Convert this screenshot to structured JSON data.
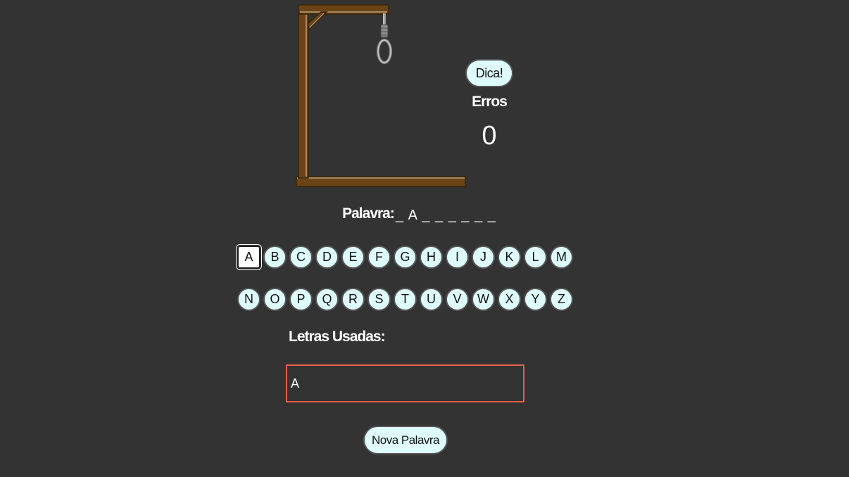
{
  "game": {
    "hint_label": "Dica!",
    "errors_label": "Erros",
    "errors_count": "0",
    "word_label": "Palavra:",
    "word_mask": "_ A _ _ _ _ _ _",
    "used_letters_label": "Letras Usadas:",
    "used_letters": "A",
    "new_word_label": "Nova Palavra"
  },
  "keyboard": {
    "row1": [
      "A",
      "B",
      "C",
      "D",
      "E",
      "F",
      "G",
      "H",
      "I",
      "J",
      "K",
      "L",
      "M"
    ],
    "row2": [
      "N",
      "O",
      "P",
      "Q",
      "R",
      "S",
      "T",
      "U",
      "V",
      "W",
      "X",
      "Y",
      "Z"
    ],
    "used": [
      "A"
    ]
  },
  "colors": {
    "background": "#333333",
    "button_fill": "#dffcfc",
    "used_box_border": "#e8604c",
    "gallows_wood": "#6b4316"
  },
  "icons": {
    "gallows": "gallows-with-noose"
  }
}
